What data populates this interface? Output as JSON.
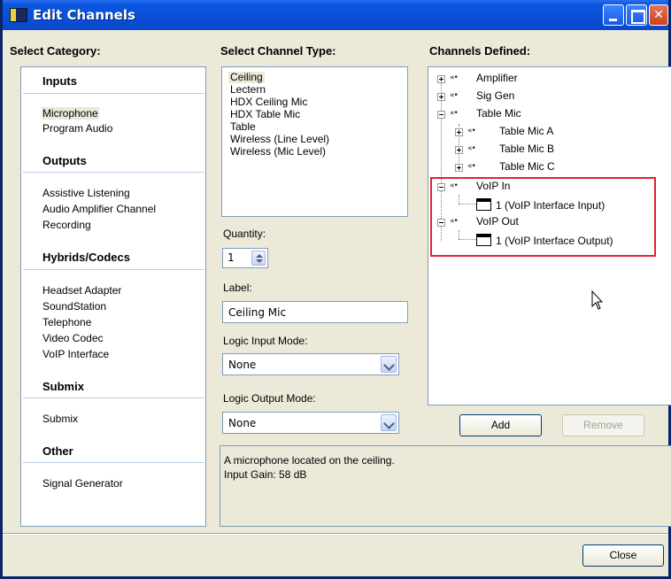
{
  "window": {
    "title": "Edit Channels"
  },
  "headers": {
    "category": "Select Category:",
    "channel_type": "Select Channel Type:",
    "channels_defined": "Channels Defined:"
  },
  "categories": {
    "inputs": {
      "title": "Inputs",
      "items": [
        "Microphone",
        "Program Audio"
      ],
      "selected": "Microphone"
    },
    "outputs": {
      "title": "Outputs",
      "items": [
        "Assistive Listening",
        "Audio Amplifier Channel",
        "Recording"
      ]
    },
    "hybrids": {
      "title": "Hybrids/Codecs",
      "items": [
        "Headset Adapter",
        "SoundStation",
        "Telephone",
        "Video Codec",
        "VoIP Interface"
      ]
    },
    "submix": {
      "title": "Submix",
      "items": [
        "Submix"
      ]
    },
    "other": {
      "title": "Other",
      "items": [
        "Signal Generator"
      ]
    }
  },
  "channel_types": {
    "items": [
      "Ceiling",
      "Lectern",
      "HDX Ceiling Mic",
      "HDX Table Mic",
      "Table",
      "Wireless (Line Level)",
      "Wireless (Mic Level)"
    ],
    "selected": "Ceiling"
  },
  "form": {
    "quantity_label": "Quantity:",
    "quantity_value": "1",
    "label_label": "Label:",
    "label_value": "Ceiling Mic",
    "logic_input_label": "Logic Input Mode:",
    "logic_input_value": "None",
    "logic_output_label": "Logic Output Mode:",
    "logic_output_value": "None"
  },
  "description": {
    "line1": "A microphone located on the ceiling.",
    "line2": "Input Gain: 58 dB"
  },
  "tree": {
    "amplifier": "Amplifier",
    "sig_gen": "Sig Gen",
    "table_mic": "Table Mic",
    "table_mic_a": "Table Mic A",
    "table_mic_b": "Table Mic B",
    "table_mic_c": "Table Mic C",
    "voip_in": "VoIP In",
    "voip_in_child": "1 (VoIP Interface Input)",
    "voip_out": "VoIP Out",
    "voip_out_child": "1 (VoIP Interface Output)"
  },
  "buttons": {
    "add": "Add",
    "remove": "Remove",
    "close": "Close"
  },
  "colors": {
    "highlight_box": "#e0242a",
    "titlebar": "#0a4fd6"
  }
}
